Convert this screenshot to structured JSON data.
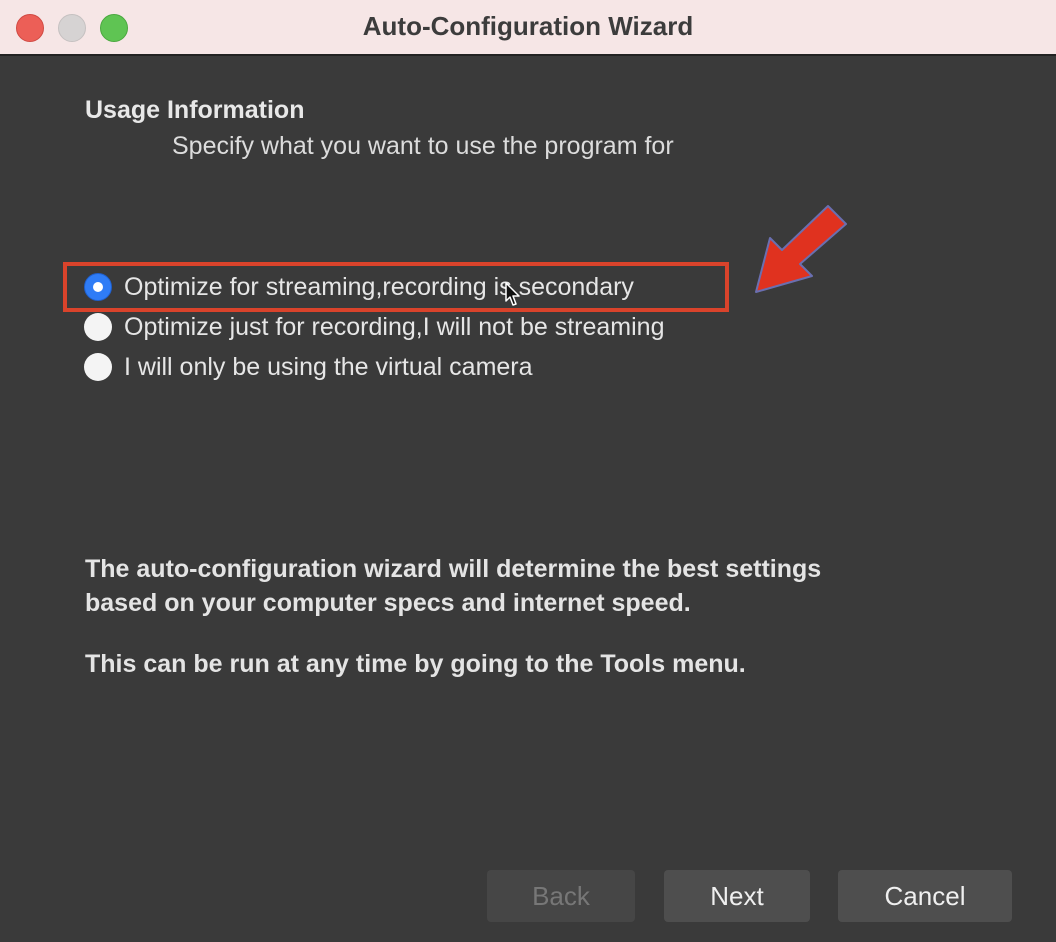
{
  "window": {
    "title": "Auto-Configuration Wizard"
  },
  "page": {
    "heading": "Usage Information",
    "subheading": "Specify what you want to use the program for"
  },
  "options": [
    {
      "label": "Optimize for streaming,recording is secondary",
      "checked": true
    },
    {
      "label": "Optimize just for recording,I will not be streaming",
      "checked": false
    },
    {
      "label": "I will only be using the virtual camera",
      "checked": false
    }
  ],
  "info": {
    "line1": "The auto-configuration wizard will determine the best settings",
    "line2": "based on your computer specs and internet speed.",
    "line3": "This can be run at any time by going to the Tools menu."
  },
  "buttons": {
    "back": "Back",
    "next": "Next",
    "cancel": "Cancel"
  },
  "colors": {
    "accent": "#2f7cf6",
    "annotation": "#d9432b",
    "window_bg": "#3a3a3a"
  }
}
